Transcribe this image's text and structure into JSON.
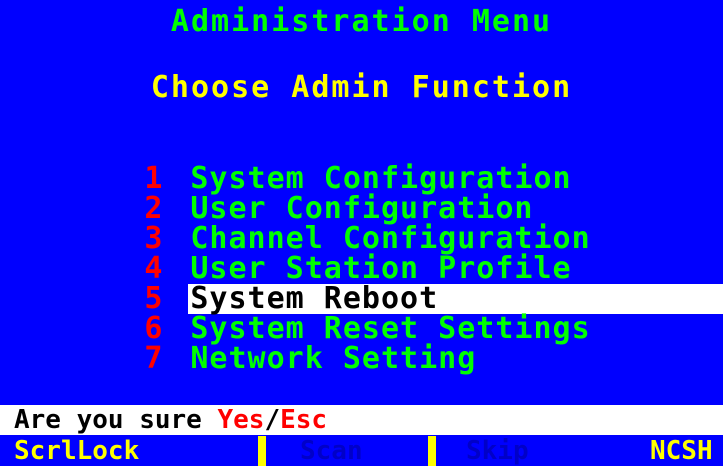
{
  "header": {
    "title": "Administration Menu",
    "subtitle": "Choose Admin Function"
  },
  "menu": {
    "items": [
      {
        "number": "1",
        "label": "System Configuration",
        "selected": false
      },
      {
        "number": "2",
        "label": "User Configuration",
        "selected": false
      },
      {
        "number": "3",
        "label": "Channel Configuration",
        "selected": false
      },
      {
        "number": "4",
        "label": "User Station Profile",
        "selected": false
      },
      {
        "number": "5",
        "label": "System Reboot",
        "selected": true
      },
      {
        "number": "6",
        "label": "System Reset Settings",
        "selected": false
      },
      {
        "number": "7",
        "label": "Network Setting",
        "selected": false
      }
    ]
  },
  "confirm": {
    "prompt": "Are you sure ",
    "yes": "Yes",
    "separator": "/",
    "esc": "Esc"
  },
  "status_bar": {
    "scrllock": "ScrlLock",
    "scan": "Scan",
    "skip": "Skip",
    "ncsh": "NCSH"
  },
  "colors": {
    "background": "#0000ff",
    "menu_text": "#00ff00",
    "subtitle_text": "#ffff00",
    "number_text": "#ff0000",
    "highlight_bg": "#ffffff",
    "highlight_text": "#000000"
  }
}
